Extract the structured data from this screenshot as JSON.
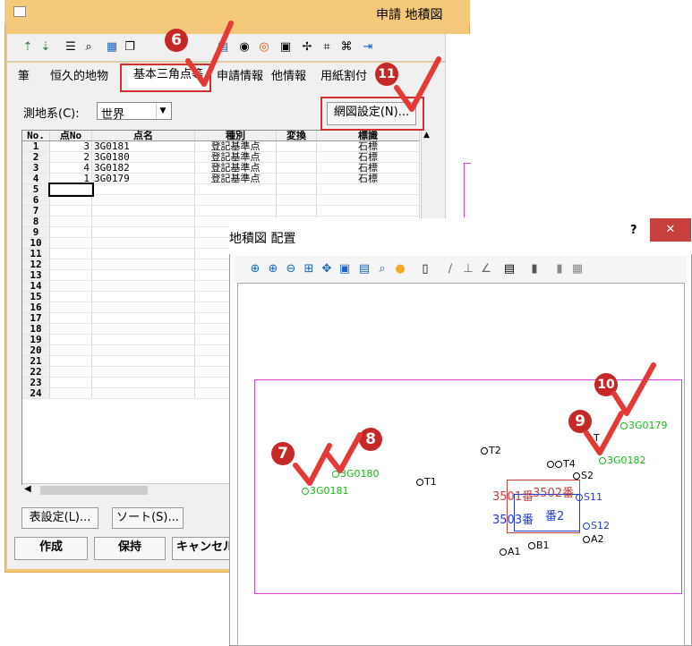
{
  "main_window": {
    "title": "申請 地積図"
  },
  "tabs": [
    "筆",
    "恒久的地物",
    "基本三角点等",
    "申請情報",
    "他情報",
    "用紙割付"
  ],
  "datum": {
    "label": "測地系(C):",
    "value": "世界"
  },
  "net_settings_button": "網図設定(N)...",
  "grid": {
    "headers": [
      "No.",
      "点No",
      "点名",
      "種別",
      "変換",
      "標識"
    ],
    "rows": [
      {
        "no": "1",
        "pno": "3",
        "name": "3G0181",
        "kind": "登記基準点",
        "conv": "",
        "mark": "石標"
      },
      {
        "no": "2",
        "pno": "2",
        "name": "3G0180",
        "kind": "登記基準点",
        "conv": "",
        "mark": "石標"
      },
      {
        "no": "3",
        "pno": "4",
        "name": "3G0182",
        "kind": "登記基準点",
        "conv": "",
        "mark": "石標"
      },
      {
        "no": "4",
        "pno": "1",
        "name": "3G0179",
        "kind": "登記基準点",
        "conv": "",
        "mark": "石標"
      },
      {
        "no": "5"
      },
      {
        "no": "6"
      },
      {
        "no": "7"
      },
      {
        "no": "8"
      },
      {
        "no": "9"
      },
      {
        "no": "10"
      },
      {
        "no": "11"
      },
      {
        "no": "12"
      },
      {
        "no": "13"
      },
      {
        "no": "14"
      },
      {
        "no": "15"
      },
      {
        "no": "16"
      },
      {
        "no": "17"
      },
      {
        "no": "18"
      },
      {
        "no": "19"
      },
      {
        "no": "20"
      },
      {
        "no": "21"
      },
      {
        "no": "22"
      },
      {
        "no": "23"
      },
      {
        "no": "24"
      }
    ]
  },
  "bottom_buttons": {
    "table_settings": "表設定(L)...",
    "sort": "ソート(S)...",
    "create": "作成",
    "hold": "保持",
    "cancel": "キャンセル"
  },
  "dialog": {
    "title": "地積図 配置",
    "help": "?",
    "close": "✕"
  },
  "plot_points": {
    "p3G0181": "3G0181",
    "p3G0180": "3G0180",
    "p3G0182": "3G0182",
    "p3G0179": "3G0179",
    "T1": "T1",
    "T2": "T2",
    "T3": "T",
    "T4": "T4",
    "S2": "S2",
    "S11": "S11",
    "S12": "S12",
    "A1": "A1",
    "A2": "A2",
    "B1": "B1",
    "lot1": "3501番",
    "lot2": "3502番",
    "lot3": "3503番",
    "lot4": "番2"
  },
  "callouts": [
    "6",
    "7",
    "8",
    "9",
    "10",
    "11"
  ],
  "colors": {
    "callout": "#c62828",
    "highlight": "#d32f2f",
    "check": "#e53935",
    "reference_point": "#18b818",
    "plot_frame": "#e040e0",
    "dialog_close": "#c8403c"
  }
}
